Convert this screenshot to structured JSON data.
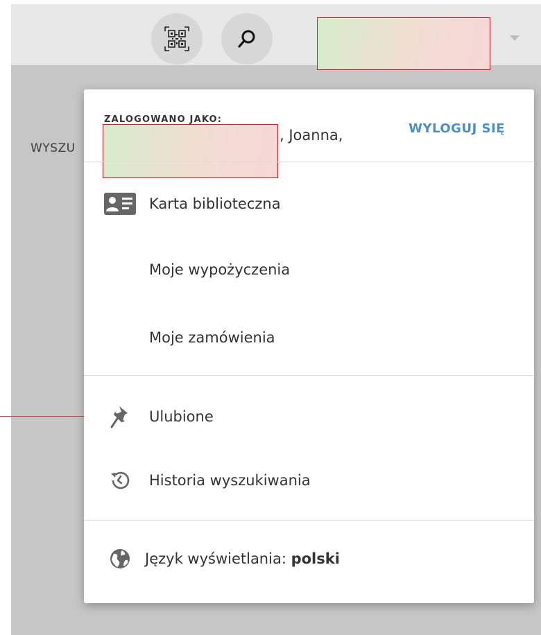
{
  "background": {
    "search_label": "WYSZU"
  },
  "menu": {
    "logged_in_label": "ZALOGOWANO JAKO:",
    "user_name_visible": ", Joanna,",
    "logout_label": "WYLOGUJ SIĘ",
    "items": [
      {
        "label": "Karta biblioteczna",
        "icon": "library-card-icon"
      },
      {
        "label": "Moje wypożyczenia",
        "icon": ""
      },
      {
        "label": "Moje zamówienia",
        "icon": ""
      },
      {
        "label": "Ulubione",
        "icon": "pin-icon"
      },
      {
        "label": "Historia wyszukiwania",
        "icon": "history-icon"
      }
    ],
    "language": {
      "label": "Język wyświetlania: ",
      "value": "polski",
      "icon": "globe-icon"
    }
  },
  "colors": {
    "accent": "#4b8fc9",
    "redaction_border": "#e0141e"
  }
}
